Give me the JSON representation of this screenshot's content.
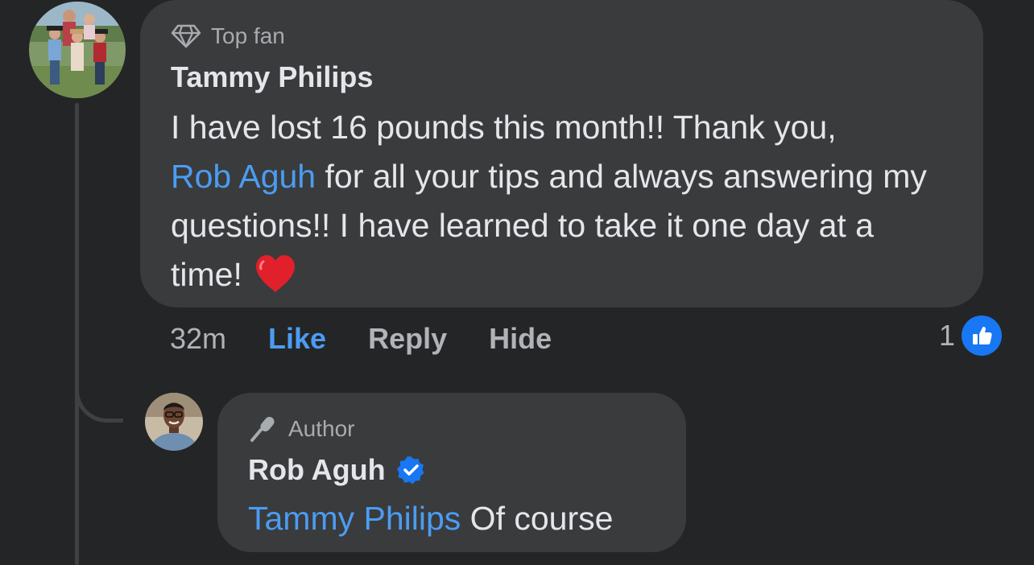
{
  "main_comment": {
    "badge": "Top fan",
    "badge_icon": "diamond-icon",
    "author": "Tammy Philips",
    "text_line1": "I have lost 16 pounds this month!! Thank you,",
    "mention": "Rob Aguh",
    "text_after_mention": " for all your tips and always answering my questions!! I have learned to take it one day at a time!",
    "emoji": "heart-emoji",
    "time": "32m",
    "actions": {
      "like": "Like",
      "reply": "Reply",
      "hide": "Hide"
    },
    "reaction_count": "1",
    "reaction_icon": "thumbs-up-icon"
  },
  "reply_comment": {
    "badge": "Author",
    "badge_icon": "microphone-icon",
    "author": "Rob Aguh",
    "verified": true,
    "mention": "Tammy Philips",
    "text": " Of course"
  },
  "colors": {
    "background": "#242526",
    "bubble": "#3a3b3c",
    "mention": "#4b9cf2",
    "like_blue": "#1877f2",
    "muted": "#b0b3b8",
    "heart": "#e0202a"
  }
}
